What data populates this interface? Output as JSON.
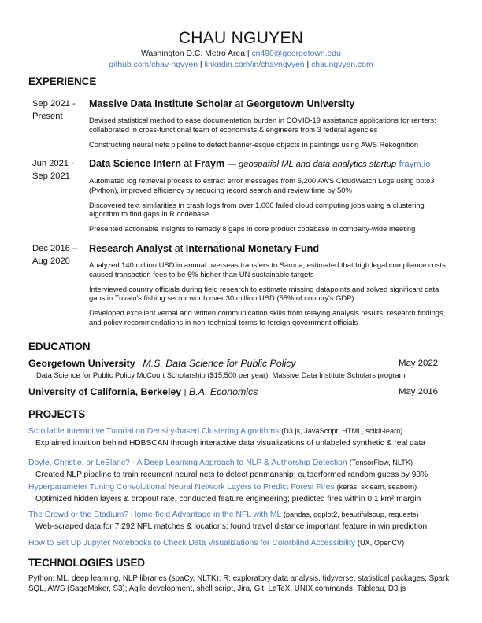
{
  "header": {
    "name": "CHAU NGUYEN",
    "location": "Washington D.C. Metro Area",
    "separator": "|",
    "email": "cn490@georgetown.edu",
    "github": "github.com/chav-ngvyen",
    "linkedin": "linkedin.com/in/chavngvyen",
    "website": "chaungvyen.com"
  },
  "sections": {
    "experience": "EXPERIENCE",
    "education": "EDUCATION",
    "projects": "PROJECTS",
    "technologies": "TECHNOLOGIES USED"
  },
  "experience": [
    {
      "dates_line1": "Sep 2021 -",
      "dates_line2": "Present",
      "role": "Massive Data Institute Scholar",
      "at": "at",
      "org": "Georgetown University",
      "bullets": [
        "Devised statistical method to ease documentation burden in COVID-19 assistance applications for renters; collaborated in cross-functional team of economists & engineers from 3 federal agencies",
        "Constructing neural nets pipeline to detect banner-esque objects in paintings using AWS Rekognition"
      ]
    },
    {
      "dates_line1": "Jun 2021 -",
      "dates_line2": "Sep 2021",
      "role": "Data Science Intern",
      "at": "at",
      "org": "Fraym",
      "tagline": "— geospatial ML and data analytics startup",
      "link": "fraym.io",
      "bullets": [
        "Automated log retrieval process to extract error messages from 5,200 AWS CloudWatch Logs using boto3 (Python), improved efficiency by reducing record search and review time by 50%",
        "Discovered text similarities in crash logs from over 1,000 failed cloud computing jobs using a clustering algorithm to find gaps in R codebase",
        "Presented actionable insights to remedy 8 gaps in core product codebase in company-wide meeting"
      ]
    },
    {
      "dates_line1": "Dec 2016 –",
      "dates_line2": "Aug 2020",
      "role": "Research Analyst",
      "at": "at",
      "org": "International Monetary Fund",
      "bullets": [
        "Analyzed 140 million USD in annual overseas transfers to Samoa; estimated that high legal compliance costs caused transaction fees to be 6% higher than UN sustainable targets",
        "Interviewed country officials during field research to estimate missing datapoints and solved significant data gaps in Tuvalu's fishing sector worth over 30 million USD (55% of country's GDP)",
        "Developed excellent verbal and written communication skills from relaying analysis results, research findings, and policy recommendations in non-technical terms to foreign government officials"
      ]
    }
  ],
  "education": [
    {
      "school": "Georgetown University",
      "sep": "|",
      "degree": "M.S. Data Science for Public Policy",
      "date": "May 2022",
      "note": "Data Science for Public Policy McCourt Scholarship ($15,500 per year), Massive Data Institute Scholars program"
    },
    {
      "school": "University of California, Berkeley",
      "sep": "|",
      "degree": "B.A. Economics",
      "date": "May 2016"
    }
  ],
  "projects": [
    {
      "title": "Scrollable Interactive Tutorial on Density-based Clustering Algorithms",
      "tools": "(D3.js, JavaScript, HTML, scikit-learn)",
      "desc": "Explained intuition behind HDBSCAN through interactive data visualizations of unlabeled synthetic & real data"
    },
    {
      "title": "Doyle, Christie, or LeBlanc? - A Deep Learning Approach to NLP & Authorship Detection",
      "tools": "(TensorFlow, NLTK)",
      "desc": "Created NLP pipeline to train recurrent neural nets to detect penmanship; outperformed random guess by 98%"
    },
    {
      "title": "Hyperparameter Tuning Convolutional Neural Network Layers to Predict Forest Fires",
      "tools": "(keras, sklearn, seaborn)",
      "desc": "Optimized hidden layers & dropout rate, conducted feature engineering; predicted fires within 0.1 km² margin"
    },
    {
      "title": "The Crowd or the Stadium? Home-field Advantage in the NFL with ML",
      "tools": "(pandas, ggplot2, beautifulsoup, requests)",
      "desc": "Web-scraped data for 7,292 NFL matches & locations; found travel distance important feature in win prediction"
    },
    {
      "title": "How to Set Up Jupyter Notebooks to Check Data Visualizations for Colorblind Accessibility",
      "tools": "(UX, OpenCV)",
      "desc": ""
    }
  ],
  "technologies": {
    "text": "Python: ML, deep learning, NLP libraries (spaCy, NLTK); R: exploratory data analysis, tidyverse, statistical packages; Spark, SQL, AWS (SageMaker, S3); Agile development, shell script, Jira, Git, LaTeX, UNIX commands, Tableau, D3.js"
  },
  "colors": {
    "link": "#4a78b8",
    "text": "#111111"
  }
}
